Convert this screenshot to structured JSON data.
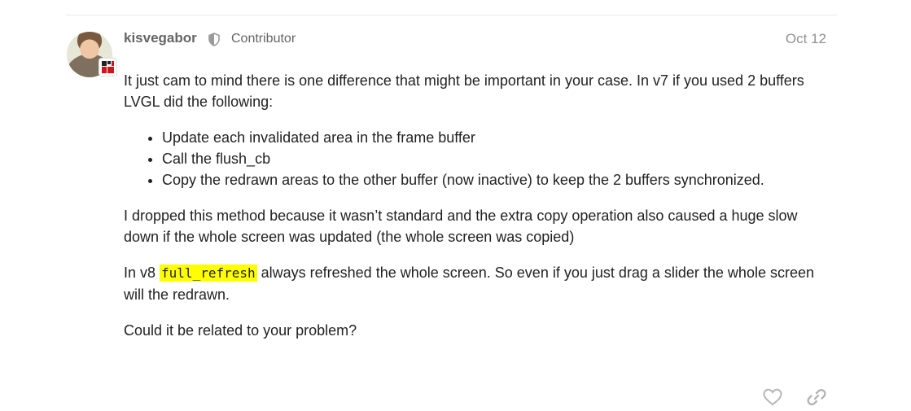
{
  "post": {
    "author": "kisvegabor",
    "role": "Contributor",
    "date": "Oct 12",
    "intro_text": "It just cam to mind there is one difference that might be important in your case. In v7 if you used 2 buffers LVGL did the following:",
    "bullets": [
      "Update each invalidated area in the frame buffer",
      "Call the flush_cb",
      "Copy the redrawn areas to the other buffer (now inactive) to keep the 2 buffers synchronized."
    ],
    "para2": "I dropped this method because it wasn’t standard and the extra copy operation also caused a huge slow down if the whole screen was updated (the whole screen was copied)",
    "para3_prefix": "In v8 ",
    "para3_code": "full_refresh",
    "para3_suffix": " always refreshed the whole screen. So even if you just drag a slider the whole screen will the redrawn.",
    "para4": "Could it be related to your problem?"
  },
  "icons": {
    "moderator_shield": "shield-icon",
    "like": "heart-icon",
    "share": "link-icon"
  },
  "colors": {
    "code_highlight": "#ffff00",
    "meta_text": "#646464",
    "date_text": "#919191",
    "icon": "#b5b5b5"
  }
}
